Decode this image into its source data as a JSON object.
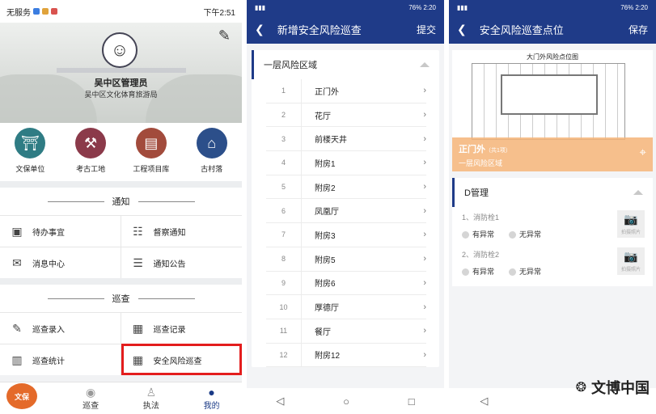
{
  "screen1": {
    "status_left": "无服务",
    "status_right": "下午2:51",
    "user_name": "吴中区管理员",
    "user_org": "吴中区文化体育旅游局",
    "top_icons": [
      {
        "label": "文保单位",
        "icon": "ding-icon",
        "color": "#2f7c84"
      },
      {
        "label": "考古工地",
        "icon": "digging-worker-icon",
        "color": "#8b3a4a"
      },
      {
        "label": "工程项目库",
        "icon": "project-board-icon",
        "color": "#a24b3c"
      },
      {
        "label": "古村落",
        "icon": "house-icon",
        "color": "#2c4f8a"
      }
    ],
    "section_notice": "通知",
    "notice_items": [
      {
        "label": "待办事宜",
        "icon": "todo-icon"
      },
      {
        "label": "督察通知",
        "icon": "supervise-icon"
      },
      {
        "label": "消息中心",
        "icon": "mail-icon"
      },
      {
        "label": "通知公告",
        "icon": "announcement-icon"
      }
    ],
    "section_patrol": "巡查",
    "patrol_items": [
      {
        "label": "巡查录入",
        "icon": "entry-icon"
      },
      {
        "label": "巡查记录",
        "icon": "record-icon"
      },
      {
        "label": "巡查统计",
        "icon": "stats-icon"
      },
      {
        "label": "安全风险巡查",
        "icon": "risk-patrol-icon"
      }
    ],
    "tabs": [
      {
        "label": "巡查",
        "icon": "eye-icon"
      },
      {
        "label": "执法",
        "icon": "law-icon"
      },
      {
        "label": "我的",
        "icon": "user-icon"
      }
    ],
    "logo_text": "文保"
  },
  "screen2": {
    "status_right": "76% 2:20",
    "title": "新增安全风险巡查",
    "action": "提交",
    "group_title": "一层风险区域",
    "rows": [
      {
        "num": "1",
        "name": "正门外"
      },
      {
        "num": "2",
        "name": "花厅"
      },
      {
        "num": "3",
        "name": "前楼天井"
      },
      {
        "num": "4",
        "name": "附房1"
      },
      {
        "num": "5",
        "name": "附房2"
      },
      {
        "num": "6",
        "name": "凤凰厅"
      },
      {
        "num": "7",
        "name": "附房3"
      },
      {
        "num": "8",
        "name": "附房5"
      },
      {
        "num": "9",
        "name": "附房6"
      },
      {
        "num": "10",
        "name": "厚德厅"
      },
      {
        "num": "11",
        "name": "餐厅"
      },
      {
        "num": "12",
        "name": "附房12"
      }
    ]
  },
  "screen3": {
    "status_right": "76% 2:20",
    "title": "安全风险巡查点位",
    "action": "保存",
    "map_title": "大门外风险点位图",
    "point_name": "正门外",
    "point_sub": "（共1项）",
    "point_area": "一层风险区域",
    "group_title": "D管理",
    "checks": [
      {
        "q": "1、消防栓1",
        "opt1": "有异常",
        "opt2": "无异常",
        "photo": "拍摄照片"
      },
      {
        "q": "2、消防栓2",
        "opt1": "有异常",
        "opt2": "无异常",
        "photo": "拍摄照片"
      }
    ]
  },
  "watermark": "文博中国"
}
